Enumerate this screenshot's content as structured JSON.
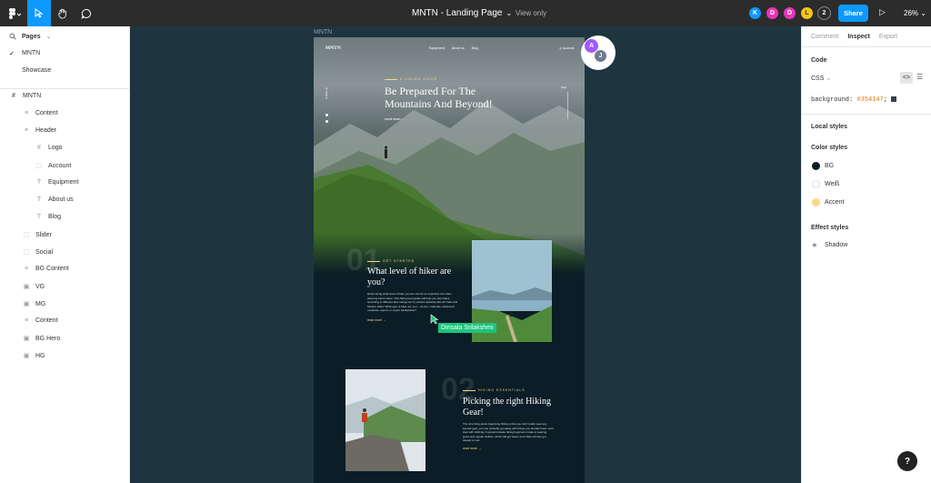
{
  "toolbar": {
    "file_title": "MNTN - Landing Page",
    "view_only": "View only",
    "collaborators": [
      {
        "initial": "K",
        "color": "#0d99ff"
      },
      {
        "initial": "D",
        "color": "#e835b7"
      },
      {
        "initial": "D",
        "color": "#e835b7"
      },
      {
        "initial": "L",
        "color": "#f5c518"
      }
    ],
    "more_count": "2",
    "share_label": "Share",
    "zoom": "26%"
  },
  "left_panel": {
    "pages_header": "Pages",
    "pages": [
      {
        "label": "MNTN",
        "selected": true
      },
      {
        "label": "Showcase",
        "selected": false
      }
    ],
    "frame_label": "MNTN",
    "layers": [
      {
        "label": "Content",
        "icon": "lines",
        "depth": 1
      },
      {
        "label": "Header",
        "icon": "lines",
        "depth": 1
      },
      {
        "label": "Logo",
        "icon": "hash",
        "depth": 2
      },
      {
        "label": "Account",
        "icon": "dashed",
        "depth": 2
      },
      {
        "label": "Equipment",
        "icon": "text",
        "depth": 2
      },
      {
        "label": "About us",
        "icon": "text",
        "depth": 2
      },
      {
        "label": "Blog",
        "icon": "text",
        "depth": 2
      },
      {
        "label": "Slider",
        "icon": "dashed",
        "depth": 1
      },
      {
        "label": "Social",
        "icon": "dashed",
        "depth": 1
      },
      {
        "label": "BG Content",
        "icon": "lines",
        "depth": 1
      },
      {
        "label": "VG",
        "icon": "image",
        "depth": 1
      },
      {
        "label": "MG",
        "icon": "image",
        "depth": 1
      },
      {
        "label": "Content",
        "icon": "lines",
        "depth": 1
      },
      {
        "label": "BG Hero",
        "icon": "image",
        "depth": 1
      },
      {
        "label": "HG",
        "icon": "image",
        "depth": 1
      }
    ]
  },
  "canvas": {
    "frame_name": "MNTN",
    "site": {
      "logo": "MNTN",
      "nav": [
        "Equipment",
        "About us",
        "Blog"
      ],
      "account": "Account",
      "hero_kicker": "A HIKING GUIDE",
      "hero_title": "Be Prepared For The Mountains And Beyond!",
      "hero_scroll": "scroll down",
      "follow": "Follow us",
      "hero_start": "Start",
      "sec1_num": "01",
      "sec1_kicker": "GET STARTED",
      "sec1_title": "What level of hiker are you?",
      "sec1_body": "Determining what level of hiker you are can be an important tool when planning future hikes. This hiking level guide will help you plan hikes according to different hike ratings set by various websites like All Trails and Modern Hiker. What type of hiker are you – novice, moderate, advanced moderate, expert, or expert backpacker?",
      "sec1_more": "read more",
      "sec2_num": "02",
      "sec2_kicker": "HIKING ESSENTIALS",
      "sec2_title": "Picking the right Hiking Gear!",
      "sec2_body": "The nice thing about beginning hiking is that you don't really need any special gear, you can probably get away with things you already have. Let's start with clothing. A typical mistake hiking beginners make is wearing jeans and regular clothes, which will get heavy and chafe wif they get sweaty or wet.",
      "sec2_more": "read more"
    },
    "cursor_user": "Dirisala Srilakshmi",
    "cursor_color": "#1bc47d",
    "canvas_avatars": [
      {
        "initial": "A",
        "color": "#a259ff"
      },
      {
        "initial": "J",
        "color": "#6b7c93"
      }
    ]
  },
  "right_panel": {
    "tabs": [
      "Comment",
      "Inspect",
      "Export"
    ],
    "active_tab": "Inspect",
    "code_header": "Code",
    "code_lang": "CSS",
    "code_property": "background:",
    "code_value": "#354147",
    "local_styles": "Local styles",
    "color_styles_header": "Color styles",
    "color_styles": [
      {
        "name": "BG",
        "color": "#0b1d26"
      },
      {
        "name": "Weiß",
        "color": "#ffffff"
      },
      {
        "name": "Accent",
        "color": "#fbd784"
      }
    ],
    "effect_styles_header": "Effect styles",
    "effect_styles": [
      {
        "name": "Shadow"
      }
    ]
  },
  "help_label": "?"
}
